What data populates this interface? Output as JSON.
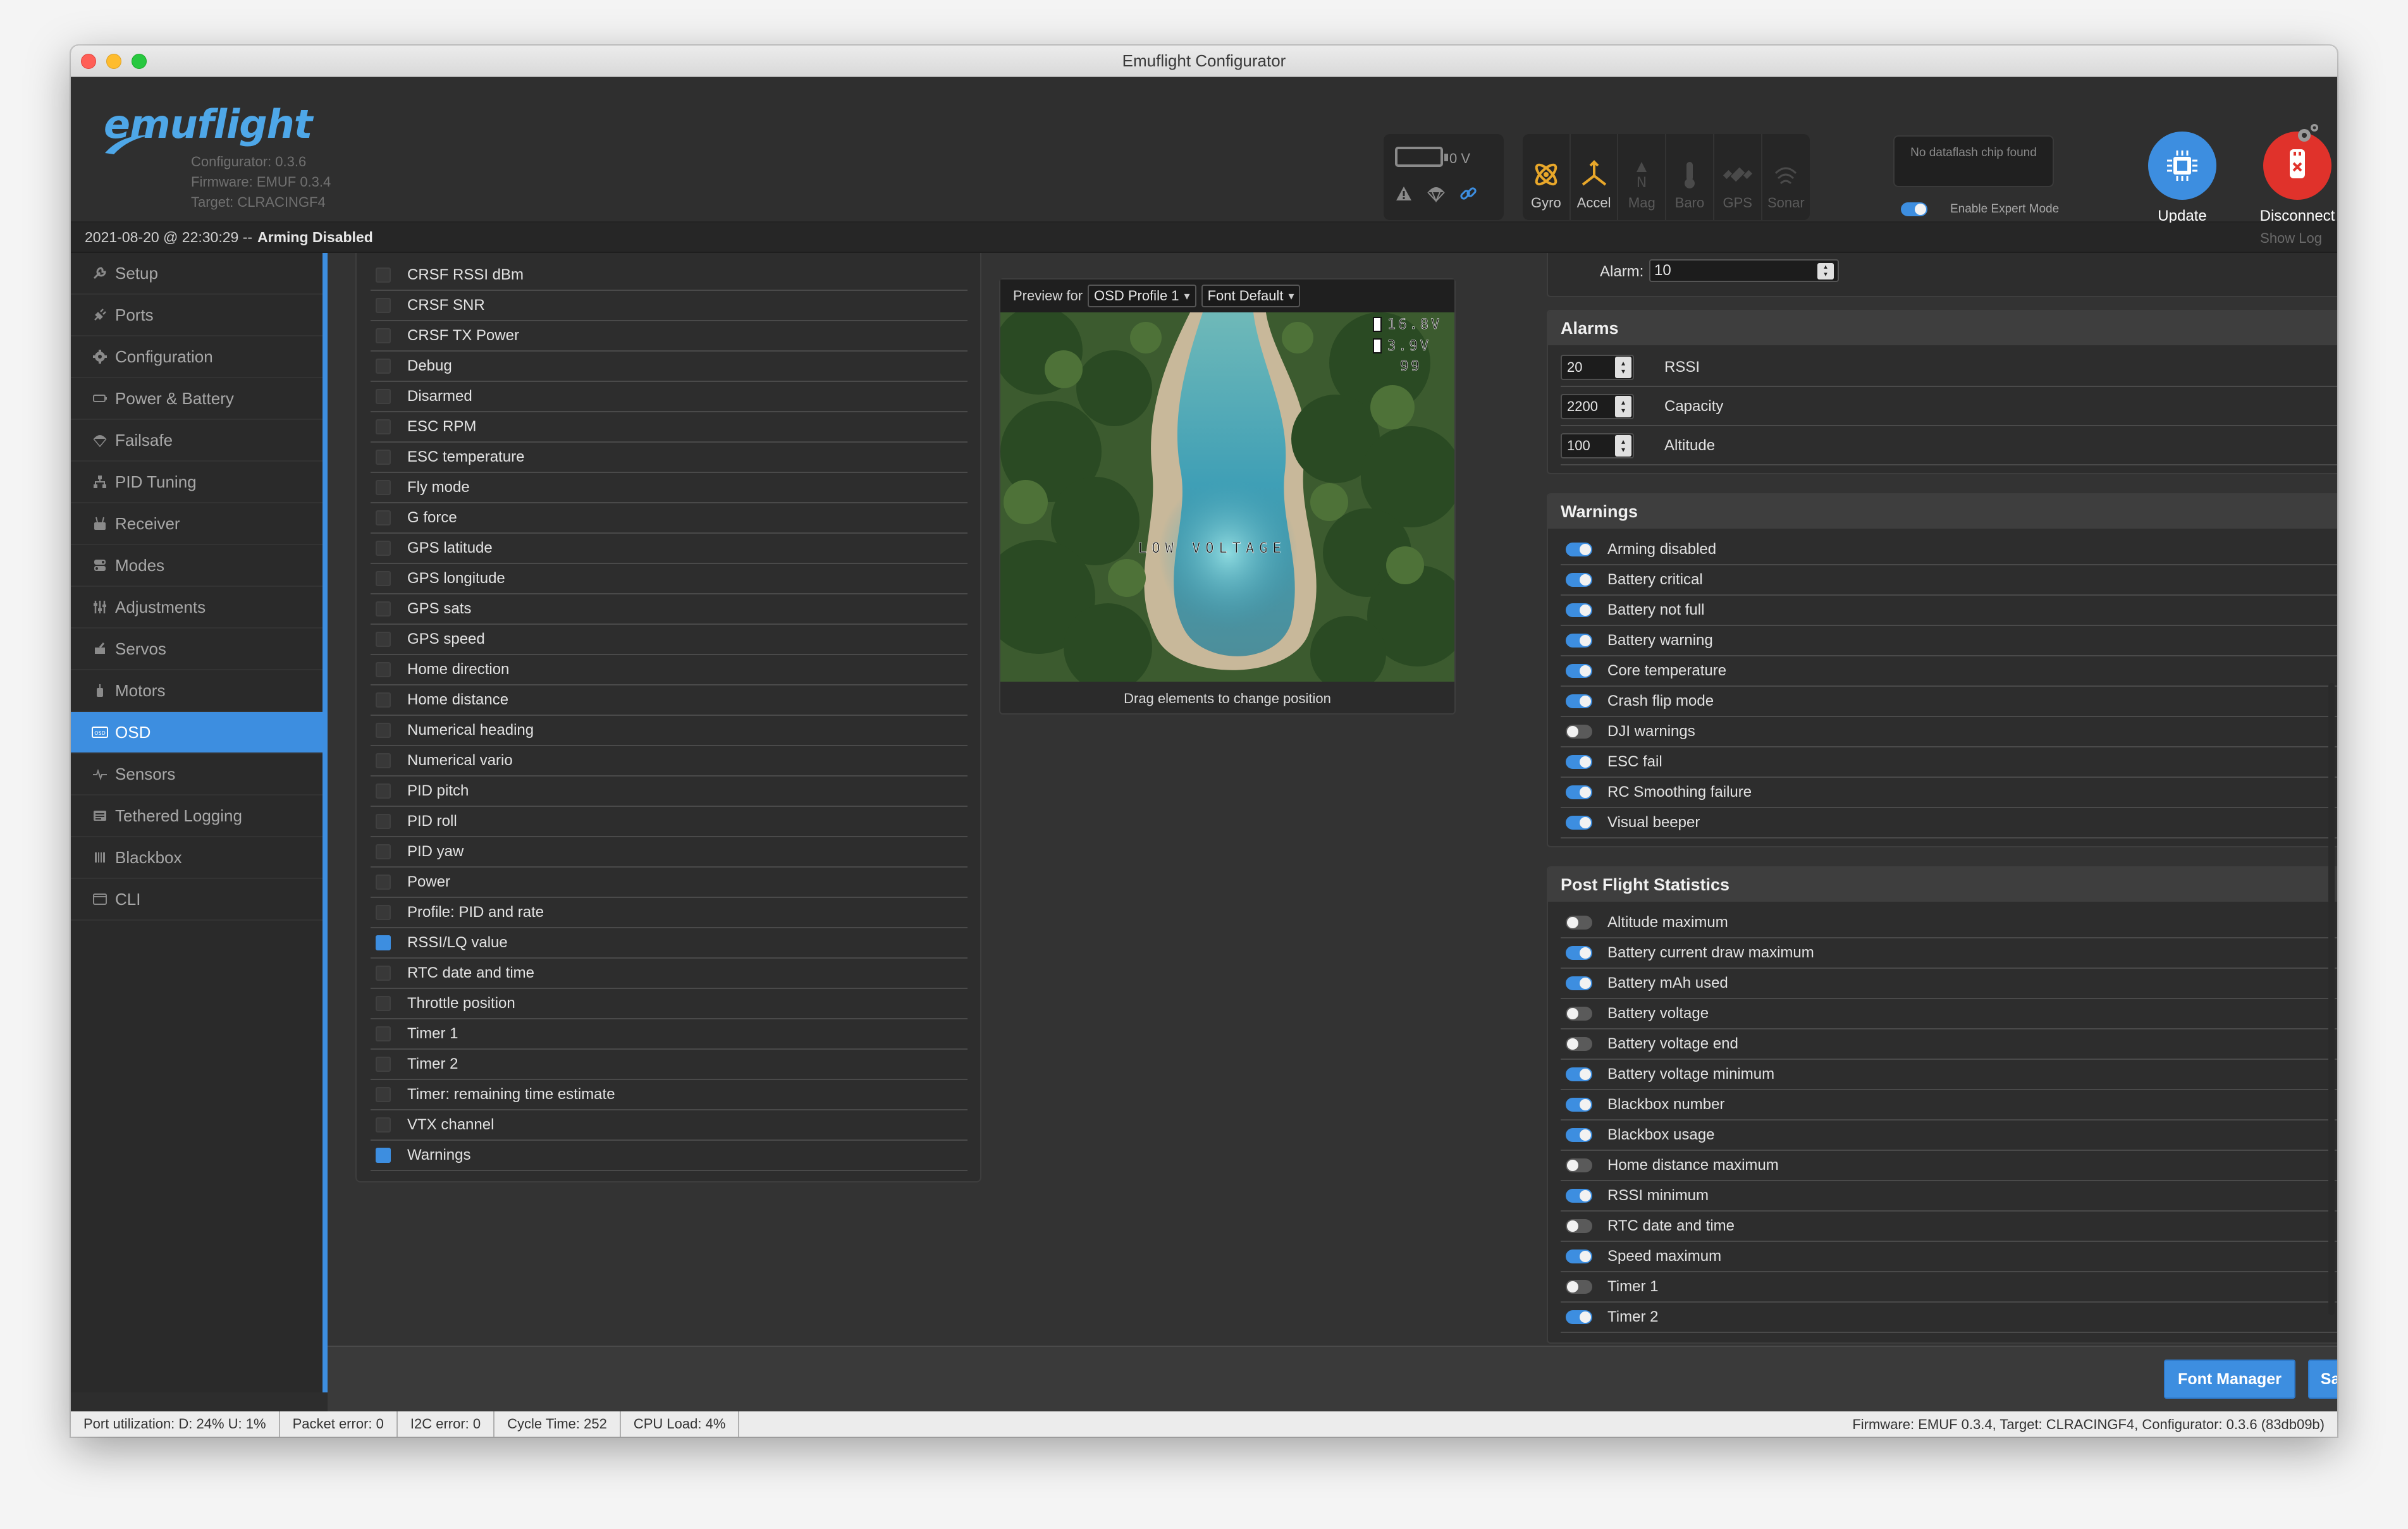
{
  "window": {
    "title": "Emuflight Configurator"
  },
  "header": {
    "logo": "emuflight",
    "configurator": "Configurator: 0.3.6",
    "firmware": "Firmware: EMUF 0.3.4",
    "target": "Target: CLRACINGF4",
    "battery_voltage": "0 V",
    "sensors": [
      {
        "label": "Gyro",
        "icon": "gyro-icon",
        "active": true
      },
      {
        "label": "Accel",
        "icon": "accel-icon",
        "active": true
      },
      {
        "label": "Mag",
        "icon": "mag-icon",
        "active": false
      },
      {
        "label": "Baro",
        "icon": "baro-icon",
        "active": false
      },
      {
        "label": "GPS",
        "icon": "gps-icon",
        "active": false
      },
      {
        "label": "Sonar",
        "icon": "sonar-icon",
        "active": false
      }
    ],
    "dataflash": "No dataflash chip found",
    "expert_mode": "Enable Expert Mode",
    "update_firmware": "Update Firmware",
    "disconnect": "Disconnect"
  },
  "status": {
    "timestamp": "2021-08-20 @ 22:30:29 --",
    "state": "Arming Disabled",
    "show_log": "Show Log"
  },
  "sidebar": {
    "items": [
      {
        "label": "Setup",
        "icon": "wrench-icon"
      },
      {
        "label": "Ports",
        "icon": "plug-icon"
      },
      {
        "label": "Configuration",
        "icon": "gear-icon"
      },
      {
        "label": "Power & Battery",
        "icon": "battery-icon"
      },
      {
        "label": "Failsafe",
        "icon": "parachute-icon"
      },
      {
        "label": "PID Tuning",
        "icon": "hierarchy-icon"
      },
      {
        "label": "Receiver",
        "icon": "receiver-icon"
      },
      {
        "label": "Modes",
        "icon": "modes-icon"
      },
      {
        "label": "Adjustments",
        "icon": "sliders-icon"
      },
      {
        "label": "Servos",
        "icon": "servo-icon"
      },
      {
        "label": "Motors",
        "icon": "motor-icon"
      },
      {
        "label": "OSD",
        "icon": "osd-icon"
      },
      {
        "label": "Sensors",
        "icon": "pulse-icon"
      },
      {
        "label": "Tethered Logging",
        "icon": "log-icon"
      },
      {
        "label": "Blackbox",
        "icon": "blackbox-icon"
      },
      {
        "label": "CLI",
        "icon": "terminal-icon"
      }
    ]
  },
  "elements": [
    {
      "label": "CRSF RSSI dBm",
      "on": false
    },
    {
      "label": "CRSF SNR",
      "on": false
    },
    {
      "label": "CRSF TX Power",
      "on": false
    },
    {
      "label": "Debug",
      "on": false
    },
    {
      "label": "Disarmed",
      "on": false
    },
    {
      "label": "ESC RPM",
      "on": false
    },
    {
      "label": "ESC temperature",
      "on": false
    },
    {
      "label": "Fly mode",
      "on": false
    },
    {
      "label": "G force",
      "on": false
    },
    {
      "label": "GPS latitude",
      "on": false
    },
    {
      "label": "GPS longitude",
      "on": false
    },
    {
      "label": "GPS sats",
      "on": false
    },
    {
      "label": "GPS speed",
      "on": false
    },
    {
      "label": "Home direction",
      "on": false
    },
    {
      "label": "Home distance",
      "on": false
    },
    {
      "label": "Numerical heading",
      "on": false
    },
    {
      "label": "Numerical vario",
      "on": false
    },
    {
      "label": "PID pitch",
      "on": false
    },
    {
      "label": "PID roll",
      "on": false
    },
    {
      "label": "PID yaw",
      "on": false
    },
    {
      "label": "Power",
      "on": false
    },
    {
      "label": "Profile: PID and rate",
      "on": false
    },
    {
      "label": "RSSI/LQ value",
      "on": true
    },
    {
      "label": "RTC date and time",
      "on": false
    },
    {
      "label": "Throttle position",
      "on": false
    },
    {
      "label": "Timer 1",
      "on": false
    },
    {
      "label": "Timer 2",
      "on": false
    },
    {
      "label": "Timer: remaining time estimate",
      "on": false
    },
    {
      "label": "VTX channel",
      "on": false
    },
    {
      "label": "Warnings",
      "on": true
    }
  ],
  "preview": {
    "label": "Preview for",
    "profile": "OSD Profile 1",
    "font": "Font Default",
    "osd_warning": "LOW VOLTAGE",
    "osd_v1": "16.8V",
    "osd_v2": "3.9V",
    "osd_rssi": "99",
    "caption": "Drag elements to change position"
  },
  "alarm_top": {
    "label": "Alarm:",
    "value": "10"
  },
  "alarms": {
    "title": "Alarms",
    "rows": [
      {
        "value": "20",
        "label": "RSSI"
      },
      {
        "value": "2200",
        "label": "Capacity"
      },
      {
        "value": "100",
        "label": "Altitude"
      }
    ]
  },
  "warnings": {
    "title": "Warnings",
    "rows": [
      {
        "label": "Arming disabled",
        "on": true
      },
      {
        "label": "Battery critical",
        "on": true
      },
      {
        "label": "Battery not full",
        "on": true
      },
      {
        "label": "Battery warning",
        "on": true
      },
      {
        "label": "Core temperature",
        "on": true
      },
      {
        "label": "Crash flip mode",
        "on": true
      },
      {
        "label": "DJI warnings",
        "on": false
      },
      {
        "label": "ESC fail",
        "on": true
      },
      {
        "label": "RC Smoothing failure",
        "on": true
      },
      {
        "label": "Visual beeper",
        "on": true
      }
    ]
  },
  "stats": {
    "title": "Post Flight Statistics",
    "rows": [
      {
        "label": "Altitude maximum",
        "on": false
      },
      {
        "label": "Battery current draw maximum",
        "on": true
      },
      {
        "label": "Battery mAh used",
        "on": true
      },
      {
        "label": "Battery voltage",
        "on": false
      },
      {
        "label": "Battery voltage end",
        "on": false
      },
      {
        "label": "Battery voltage minimum",
        "on": true
      },
      {
        "label": "Blackbox number",
        "on": true
      },
      {
        "label": "Blackbox usage",
        "on": true
      },
      {
        "label": "Home distance maximum",
        "on": false
      },
      {
        "label": "RSSI minimum",
        "on": true
      },
      {
        "label": "RTC date and time",
        "on": false
      },
      {
        "label": "Speed maximum",
        "on": true
      },
      {
        "label": "Timer 1",
        "on": false
      },
      {
        "label": "Timer 2",
        "on": true
      }
    ]
  },
  "toolbar": {
    "font_manager": "Font Manager",
    "save": "Save"
  },
  "footer": {
    "port": "Port utilization: D: 24% U: 1%",
    "packet": "Packet error: 0",
    "i2c": "I2C error: 0",
    "cycle": "Cycle Time: 252",
    "cpu": "CPU Load: 4%",
    "version": "Firmware: EMUF 0.3.4, Target: CLRACINGF4, Configurator: 0.3.6 (83db09b)"
  },
  "colors": {
    "accent": "#3d8ee0",
    "danger": "#e0322b",
    "sensor_active": "#e8a72a"
  }
}
